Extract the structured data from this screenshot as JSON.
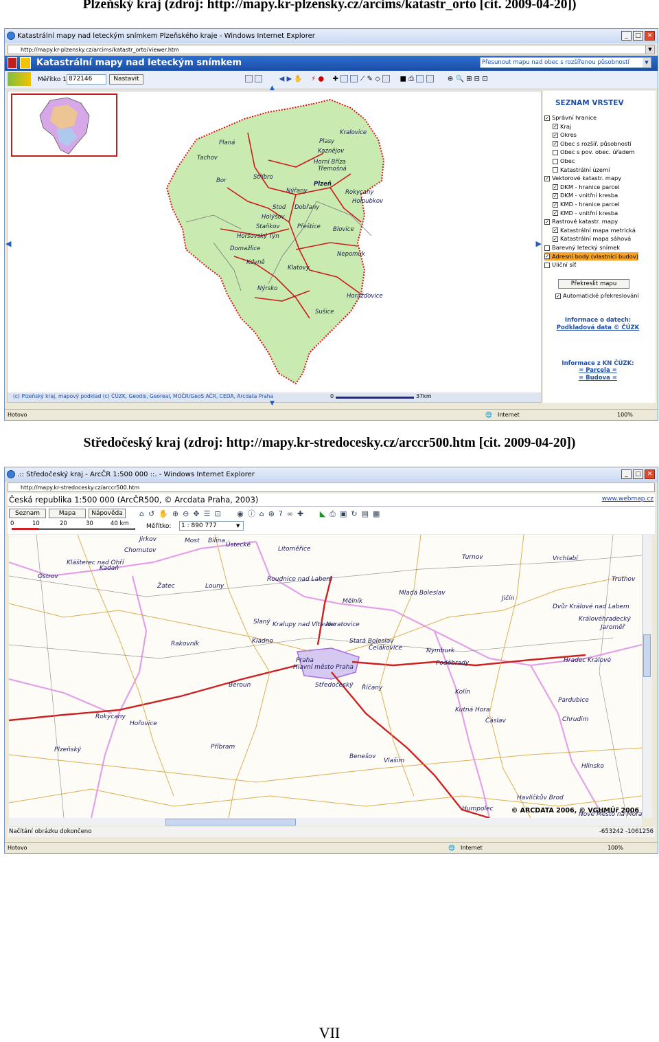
{
  "captions": {
    "top": "Plzeňský kraj (zdroj: http://mapy.kr-plzensky.cz/arcims/katastr_orto [cit. 2009-04-20])",
    "middle": "Středočeský kraj (zdroj: http://mapy.kr-stredocesky.cz/arccr500.htm [cit. 2009-04-20])"
  },
  "page_number": "VII",
  "window1": {
    "title": "Katastrální mapy nad leteckým snímkem Plzeňského kraje - Windows Internet Explorer",
    "url": "http://mapy.kr-plzensky.cz/arcims/katastr_orto/viewer.htm",
    "app_title": "Katastrální mapy nad leteckým snímkem",
    "scale_label": "Měřítko 1:",
    "scale_value": "872146",
    "set_button": "Nastavit",
    "search_select": "Přesunout mapu nad obec s rozšířenou působností",
    "layer_panel_title": "SEZNAM VRSTEV",
    "layers": [
      {
        "label": "Správní hranice",
        "checked": true,
        "indent": 0
      },
      {
        "label": "Kraj",
        "checked": true,
        "indent": 1
      },
      {
        "label": "Okres",
        "checked": true,
        "indent": 1
      },
      {
        "label": "Obec s rozšíř. působností",
        "checked": true,
        "indent": 1
      },
      {
        "label": "Obec s pov. obec. úřadem",
        "checked": false,
        "indent": 1
      },
      {
        "label": "Obec",
        "checked": false,
        "indent": 1
      },
      {
        "label": "Katastrální území",
        "checked": false,
        "indent": 1
      },
      {
        "label": "Vektorové katastr. mapy",
        "checked": true,
        "indent": 0
      },
      {
        "label": "DKM - hranice parcel",
        "checked": true,
        "indent": 1
      },
      {
        "label": "DKM - vnitřní kresba",
        "checked": true,
        "indent": 1
      },
      {
        "label": "KMD - hranice parcel",
        "checked": true,
        "indent": 1
      },
      {
        "label": "KMD - vnitřní kresba",
        "checked": true,
        "indent": 1
      },
      {
        "label": "Rastrové katastr. mapy",
        "checked": true,
        "indent": 0
      },
      {
        "label": "Katastrální mapa metrická",
        "checked": true,
        "indent": 1
      },
      {
        "label": "Katastrální mapa sáhová",
        "checked": true,
        "indent": 1
      },
      {
        "label": "Barevný letecký snímek",
        "checked": false,
        "indent": 0
      },
      {
        "label": "Adresní body (vlastníci budov)",
        "checked": true,
        "indent": 0,
        "highlight": true
      },
      {
        "label": "Uliční síť",
        "checked": false,
        "indent": 0
      }
    ],
    "redraw_button": "Překreslit mapu",
    "auto_redraw": "Automatické překreslování",
    "info_data_title": "Informace o datech:",
    "info_data_link": "Podkladová data © ČÚZK",
    "info_kn_title": "Informace z KN ČÚZK:",
    "info_kn_parcel": "= Parcela =",
    "info_kn_building": "= Budova =",
    "copyright": "(c) Plzeňský kraj, mapový podklad (c) ČÚZK, Geodis, Georeal, MOČR/GeoS AČR, CEDA, Arcdata Praha",
    "scalebar_start": "0",
    "scalebar_end": "37km",
    "status_left": "Hotovo",
    "status_zone": "Internet",
    "zoom": "100%",
    "cities": [
      "Kralovice",
      "Plasy",
      "Kaznějov",
      "Planá",
      "Tachov",
      "Horní Bříza",
      "Třemošná",
      "Bor",
      "Stříbro",
      "Nýřany",
      "Plzeň",
      "Rokycany",
      "Holoubkov",
      "Stod",
      "Dobřany",
      "Holýšov",
      "Staňkov",
      "Přeštice",
      "Blovice",
      "Horšovský Týn",
      "Domažlice",
      "Nepomuk",
      "Kdyně",
      "Klatovy",
      "Nýrsko",
      "Horažďovice",
      "Sušice"
    ],
    "colors": {
      "title_bar_blue": "#1f5fb8",
      "district_red": "#cc1a1a",
      "land_green": "#b8e6a0",
      "panel_title": "#1e4fa8"
    }
  },
  "window2": {
    "title": ".:: Středočeský kraj - ArcČR 1:500 000 ::. - Windows Internet Explorer",
    "url": "http://mapy.kr-stredocesky.cz/arccr500.htm",
    "app_title": "Česká republika 1:500 000 (ArcČR500, © Arcdata Praha, 2003)",
    "link": "www.webmap.cz",
    "tabs": [
      "Seznam",
      "Mapa",
      "Nápověda"
    ],
    "scalebar_ticks": [
      "0",
      "10",
      "20",
      "30",
      "40 km"
    ],
    "scale_label": "Měřítko:",
    "scale_value": "1 : 890 777",
    "copyright_right": "© ARCDATA 2006, © VGHMÚř 2006",
    "status_left": "Načítání obrázku dokončeno",
    "coords": "-653242 -1061256",
    "status_left2": "Hotovo",
    "status_zone": "Internet",
    "zoom": "100%",
    "cities": [
      "Jirkov",
      "Most",
      "Bílina",
      "Ústecké",
      "Chomutov",
      "Litoměřice",
      "Klášterec nad Ohří",
      "Kadaň",
      "Turnov",
      "Vrchlabí",
      "Ostrov",
      "Žatec",
      "Louny",
      "Roudnice nad Labem",
      "Mělník",
      "Mladá Boleslav",
      "Trutnov",
      "Jičín",
      "Dvůr Králové nad Labem",
      "Královéhradecký",
      "Jaroměř",
      "Slaný",
      "Kralupy nad Vltavou",
      "Neratovice",
      "Rakovník",
      "Kladno",
      "Stará Boleslav",
      "Čelákovice",
      "Nymburk",
      "Poděbrady",
      "Hradec Králové",
      "Hlavní město Praha",
      "Praha",
      "Beroun",
      "Středočeský",
      "Říčany",
      "Kolín",
      "Pardubice",
      "Kutná Hora",
      "Chrudim",
      "Čáslav",
      "Hořovice",
      "Rokycany",
      "Příbram",
      "Plzeňský",
      "Benešov",
      "Vlašim",
      "Hlinsko",
      "Havlíčkův Brod",
      "Humpolec",
      "Nové Město na Moravě"
    ]
  }
}
